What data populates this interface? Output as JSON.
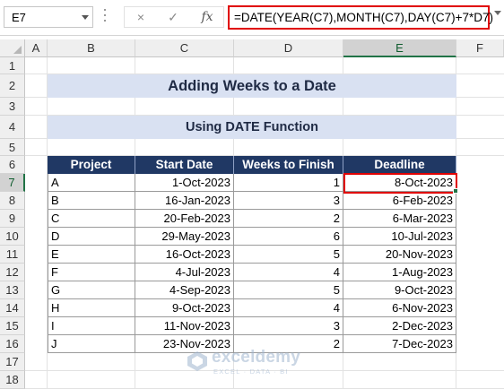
{
  "formula_bar": {
    "name_box": "E7",
    "cancel_icon": "×",
    "enter_icon": "✓",
    "fx_label": "fx",
    "formula": "=DATE(YEAR(C7),MONTH(C7),DAY(C7)+7*D7)"
  },
  "columns": [
    "A",
    "B",
    "C",
    "D",
    "E",
    "F"
  ],
  "active_column": "E",
  "rows": [
    "1",
    "2",
    "3",
    "4",
    "5",
    "6",
    "7",
    "8",
    "9",
    "10",
    "11",
    "12",
    "13",
    "14",
    "15",
    "16",
    "17",
    "18"
  ],
  "active_row": "7",
  "sheet": {
    "title": "Adding Weeks to a Date",
    "subtitle": "Using DATE Function",
    "table": {
      "headers": [
        "Project",
        "Start Date",
        "Weeks to Finish",
        "Deadline"
      ],
      "rows": [
        [
          "A",
          "1-Oct-2023",
          "1",
          "8-Oct-2023"
        ],
        [
          "B",
          "16-Jan-2023",
          "3",
          "6-Feb-2023"
        ],
        [
          "C",
          "20-Feb-2023",
          "2",
          "6-Mar-2023"
        ],
        [
          "D",
          "29-May-2023",
          "6",
          "10-Jul-2023"
        ],
        [
          "E",
          "16-Oct-2023",
          "5",
          "20-Nov-2023"
        ],
        [
          "F",
          "4-Jul-2023",
          "4",
          "1-Aug-2023"
        ],
        [
          "G",
          "4-Sep-2023",
          "5",
          "9-Oct-2023"
        ],
        [
          "H",
          "9-Oct-2023",
          "4",
          "6-Nov-2023"
        ],
        [
          "I",
          "11-Nov-2023",
          "3",
          "2-Dec-2023"
        ],
        [
          "J",
          "23-Nov-2023",
          "2",
          "7-Dec-2023"
        ]
      ]
    }
  },
  "watermark": {
    "name": "exceldemy",
    "tagline": "EXCEL · DATA · BI"
  },
  "colors": {
    "header_fill": "#203864",
    "band_fill": "#d9e1f2",
    "highlight": "#e00000",
    "excel_green": "#217346"
  }
}
